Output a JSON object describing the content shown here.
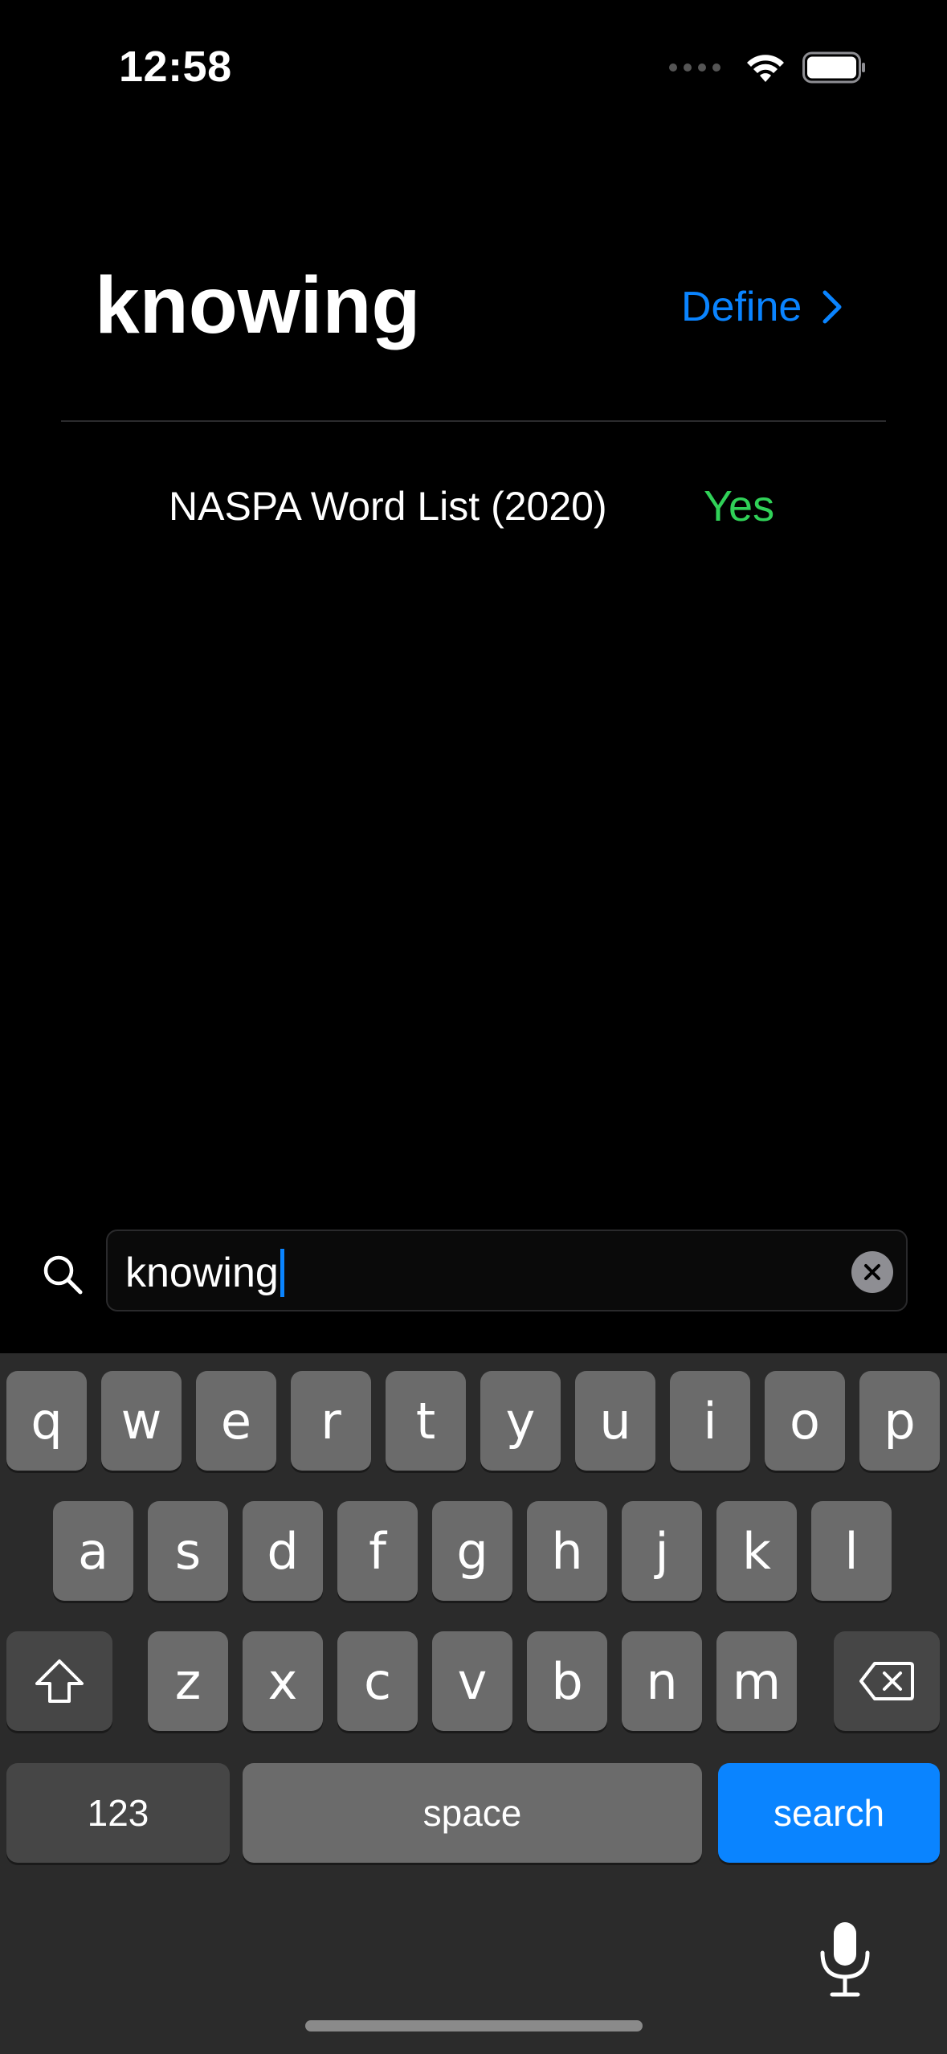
{
  "status_bar": {
    "time": "12:58"
  },
  "header": {
    "word": "knowing",
    "define_label": "Define"
  },
  "result": {
    "list_name": "NASPA Word List (2020)",
    "status": "Yes",
    "status_color": "#30d158"
  },
  "search": {
    "value": "knowing"
  },
  "keyboard": {
    "row1": [
      "q",
      "w",
      "e",
      "r",
      "t",
      "y",
      "u",
      "i",
      "o",
      "p"
    ],
    "row2": [
      "a",
      "s",
      "d",
      "f",
      "g",
      "h",
      "j",
      "k",
      "l"
    ],
    "row3": [
      "z",
      "x",
      "c",
      "v",
      "b",
      "n",
      "m"
    ],
    "numbers_label": "123",
    "space_label": "space",
    "search_label": "search"
  },
  "colors": {
    "accent": "#0a84ff",
    "background": "#000000",
    "keyboard_bg": "#2b2b2b"
  }
}
